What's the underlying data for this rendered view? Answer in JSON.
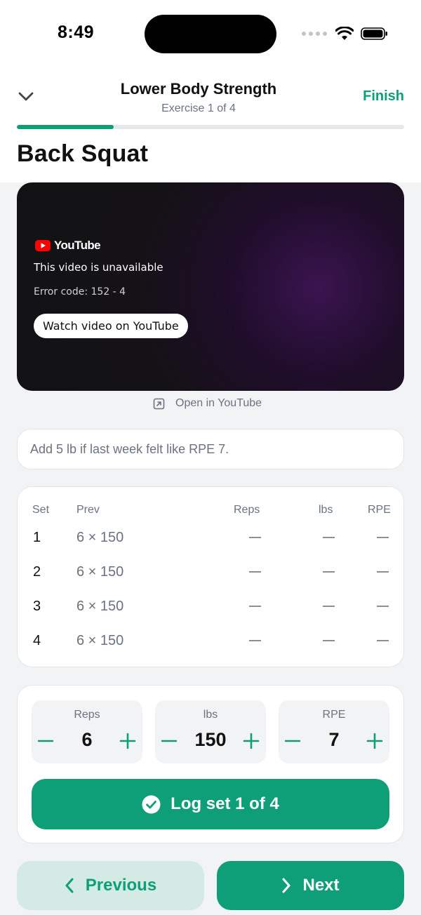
{
  "status_bar": {
    "time": "8:49"
  },
  "header": {
    "workout_title": "Lower Body Strength",
    "subtitle": "Exercise 1 of 4",
    "finish_label": "Finish",
    "progress_fraction": 0.25
  },
  "exercise": {
    "name": "Back Squat"
  },
  "video": {
    "brand": "YouTube",
    "message": "This video is unavailable",
    "error": "Error code: 152 - 4",
    "watch_label": "Watch video on YouTube",
    "open_link_label": "Open in YouTube"
  },
  "note": {
    "text": "Add 5 lb if last week felt like RPE 7."
  },
  "sets_table": {
    "headers": {
      "set": "Set",
      "prev": "Prev",
      "reps": "Reps",
      "lbs": "lbs",
      "rpe": "RPE"
    },
    "rows": [
      {
        "set": "1",
        "prev": "6 × 150"
      },
      {
        "set": "2",
        "prev": "6 × 150"
      },
      {
        "set": "3",
        "prev": "6 × 150"
      },
      {
        "set": "4",
        "prev": "6 × 150"
      }
    ]
  },
  "entry": {
    "reps": {
      "label": "Reps",
      "value": "6"
    },
    "lbs": {
      "label": "lbs",
      "value": "150"
    },
    "rpe": {
      "label": "RPE",
      "value": "7"
    },
    "log_label": "Log set 1 of 4"
  },
  "nav": {
    "previous_label": "Previous",
    "next_label": "Next"
  },
  "colors": {
    "accent": "#0e9f79",
    "accent_soft": "#d3ebe4",
    "background": "#f2f3f5",
    "youtube_red": "#ff0000"
  }
}
